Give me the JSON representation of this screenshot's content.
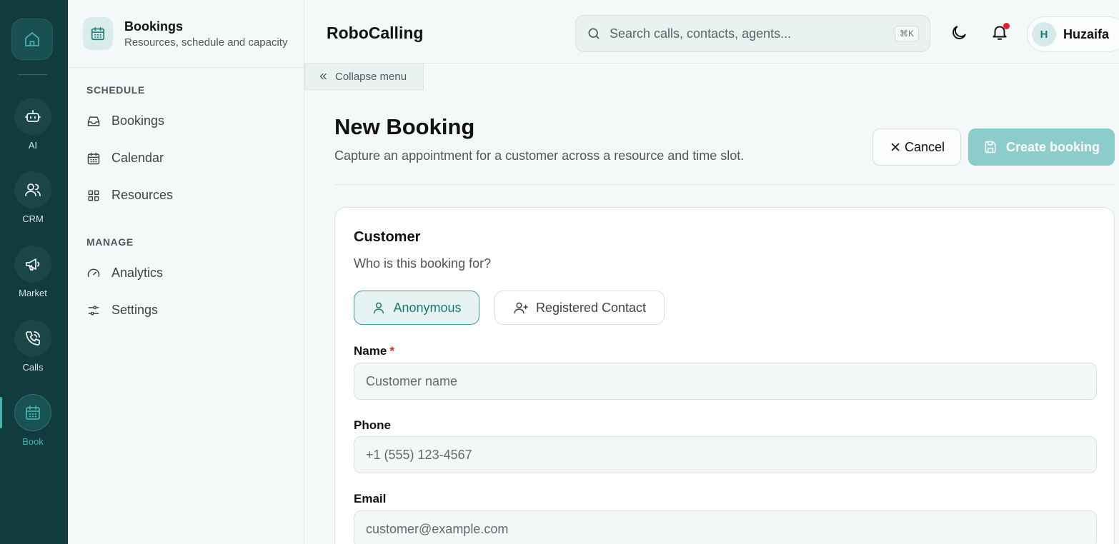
{
  "rail": {
    "items": [
      {
        "label": "AI"
      },
      {
        "label": "CRM"
      },
      {
        "label": "Market"
      },
      {
        "label": "Calls"
      },
      {
        "label": "Book"
      }
    ]
  },
  "sidebar": {
    "title": "Bookings",
    "subtitle": "Resources, schedule and capacity",
    "sections": [
      {
        "heading": "SCHEDULE",
        "items": [
          {
            "label": "Bookings"
          },
          {
            "label": "Calendar"
          },
          {
            "label": "Resources"
          }
        ]
      },
      {
        "heading": "MANAGE",
        "items": [
          {
            "label": "Analytics"
          },
          {
            "label": "Settings"
          }
        ]
      }
    ]
  },
  "topbar": {
    "brand": "RoboCalling",
    "search_placeholder": "Search calls, contacts, agents...",
    "shortcut": "⌘K",
    "user_initial": "H",
    "user_name": "Huzaifa"
  },
  "collapse_label": "Collapse menu",
  "page": {
    "title": "New Booking",
    "subtitle": "Capture an appointment for a customer across a resource and time slot.",
    "cancel_label": "Cancel",
    "create_label": "Create booking"
  },
  "customer": {
    "title": "Customer",
    "subtitle": "Who is this booking for?",
    "toggle_anonymous": "Anonymous",
    "toggle_registered": "Registered Contact",
    "name_label": "Name",
    "required_mark": "*",
    "name_placeholder": "Customer name",
    "phone_label": "Phone",
    "phone_placeholder": "+1 (555) 123-4567",
    "email_label": "Email",
    "email_placeholder": "customer@example.com"
  },
  "colors": {
    "rail_bg": "#113b3d",
    "accent": "#3aa09e",
    "create_button": "#8ccccb"
  }
}
